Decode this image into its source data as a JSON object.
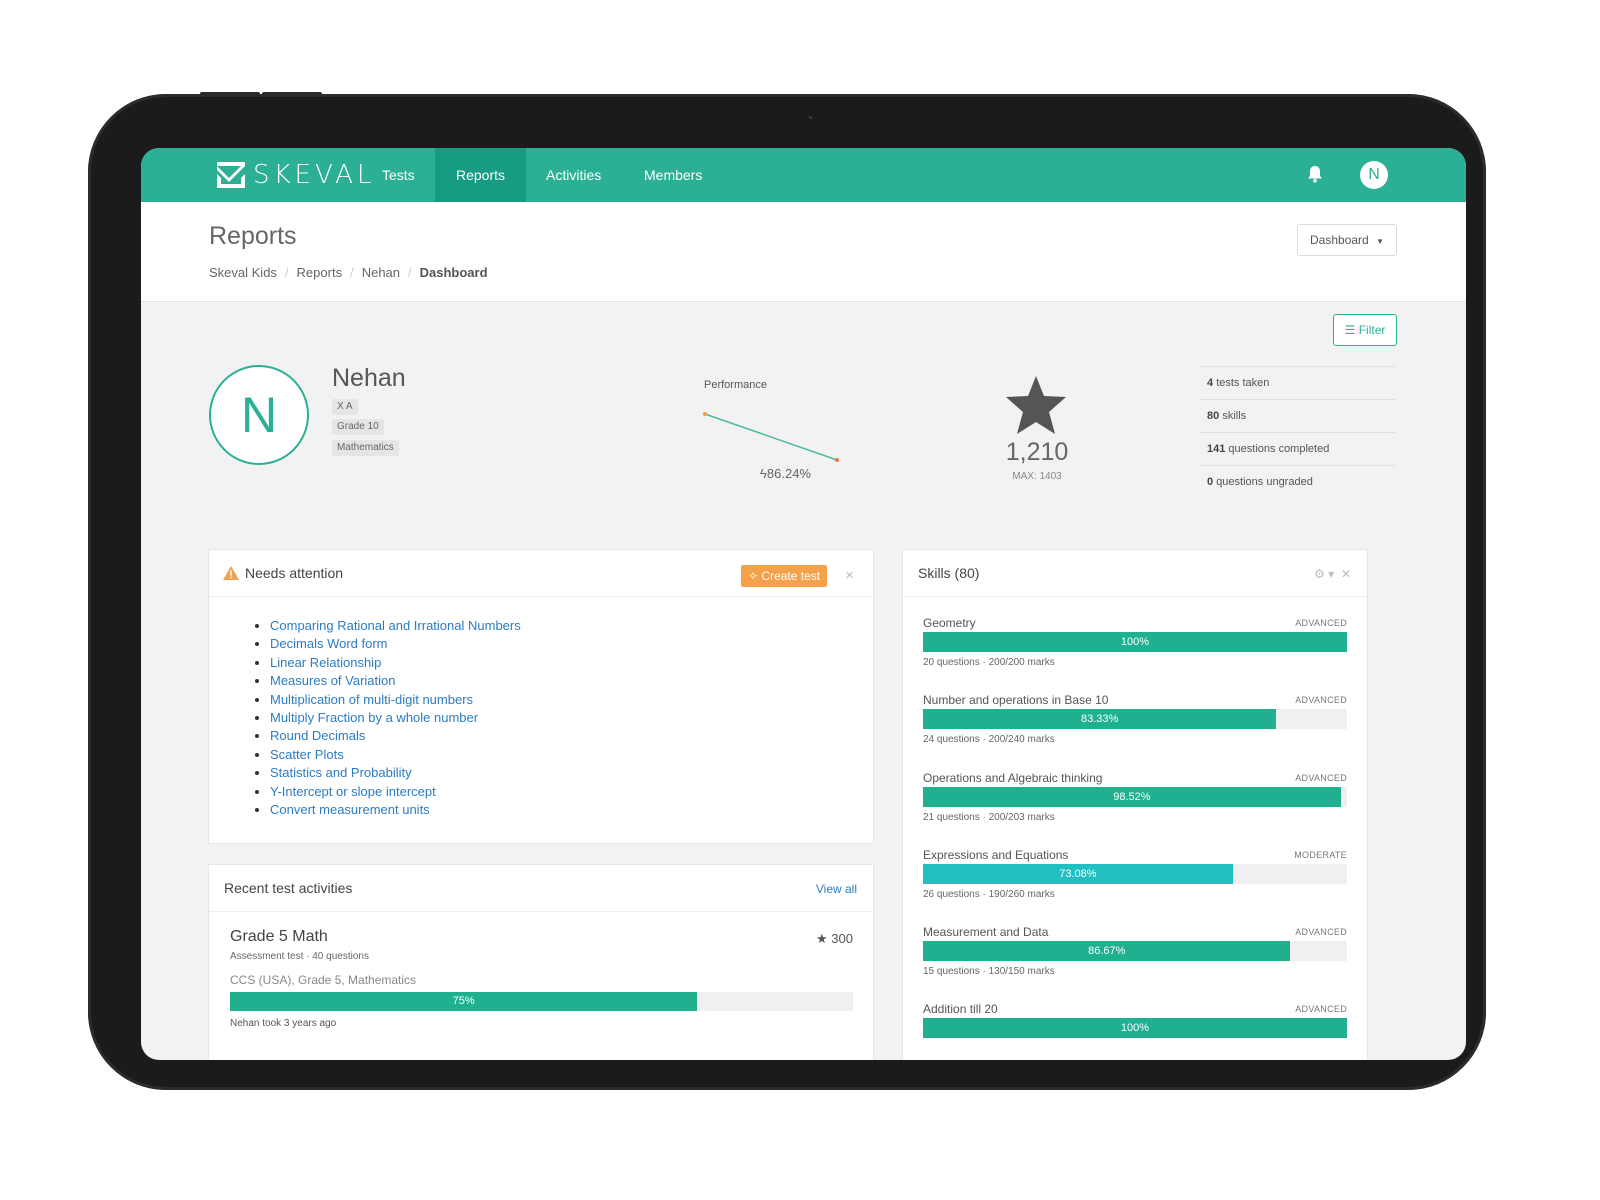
{
  "nav": {
    "brand": "SKEVAL",
    "items": [
      "Tests",
      "Reports",
      "Activities",
      "Members"
    ],
    "active": "Reports",
    "avatar_letter": "N",
    "accent_color": "#2bb096",
    "bell_icon": "bell-icon"
  },
  "header": {
    "title": "Reports",
    "breadcrumb": [
      "Skeval Kids",
      "Reports",
      "Nehan",
      "Dashboard"
    ],
    "dropdown_label": "Dashboard",
    "filter_label": "Filter"
  },
  "profile": {
    "avatar_letter": "N",
    "name": "Nehan",
    "tags": [
      "X A",
      "Grade 10",
      "Mathematics"
    ]
  },
  "performance": {
    "label": "Performance",
    "value": "86.24%"
  },
  "score": {
    "value": "1,210",
    "max_label": "MAX: 1403"
  },
  "stats": [
    {
      "count": "4",
      "label": "tests taken"
    },
    {
      "count": "80",
      "label": "skills"
    },
    {
      "count": "141",
      "label": "questions completed"
    },
    {
      "count": "0",
      "label": "questions ungraded"
    }
  ],
  "attention": {
    "title": "Needs attention",
    "create_label": "Create test",
    "items": [
      "Comparing Rational and Irrational Numbers",
      "Decimals Word form",
      "Linear Relationship",
      "Measures of Variation",
      "Multiplication of multi-digit numbers",
      "Multiply Fraction by a whole number",
      "Round Decimals",
      "Scatter Plots",
      "Statistics and Probability",
      "Y-Intercept or slope intercept",
      "Convert measurement units"
    ]
  },
  "recent": {
    "title": "Recent test activities",
    "view_all": "View all",
    "test": {
      "title": "Grade 5 Math",
      "sub": "Assessment test · 40 questions",
      "meta": "CCS (USA), Grade 5, Mathematics",
      "points": "300",
      "progress": 75,
      "progress_label": "75%",
      "took": "Nehan took 3 years ago"
    }
  },
  "skills": {
    "title": "Skills (80)",
    "items": [
      {
        "name": "Geometry",
        "level": "ADVANCED",
        "percent": 100,
        "label": "100%",
        "meta": "20 questions  ·  200/200 marks",
        "color": "#1fb090"
      },
      {
        "name": "Number and operations in Base 10",
        "level": "ADVANCED",
        "percent": 83.33,
        "label": "83.33%",
        "meta": "24 questions  ·  200/240 marks",
        "color": "#1fb090"
      },
      {
        "name": "Operations and Algebraic thinking",
        "level": "ADVANCED",
        "percent": 98.52,
        "label": "98.52%",
        "meta": "21 questions  ·  200/203 marks",
        "color": "#1fb090"
      },
      {
        "name": "Expressions and Equations",
        "level": "MODERATE",
        "percent": 73.08,
        "label": "73.08%",
        "meta": "26 questions  ·  190/260 marks",
        "color": "#22bfc2"
      },
      {
        "name": "Measurement and Data",
        "level": "ADVANCED",
        "percent": 86.67,
        "label": "86.67%",
        "meta": "15 questions  ·  130/150 marks",
        "color": "#1fb090"
      },
      {
        "name": "Addition till 20",
        "level": "ADVANCED",
        "percent": 100,
        "label": "100%",
        "meta": "",
        "color": "#1fb090"
      }
    ]
  }
}
